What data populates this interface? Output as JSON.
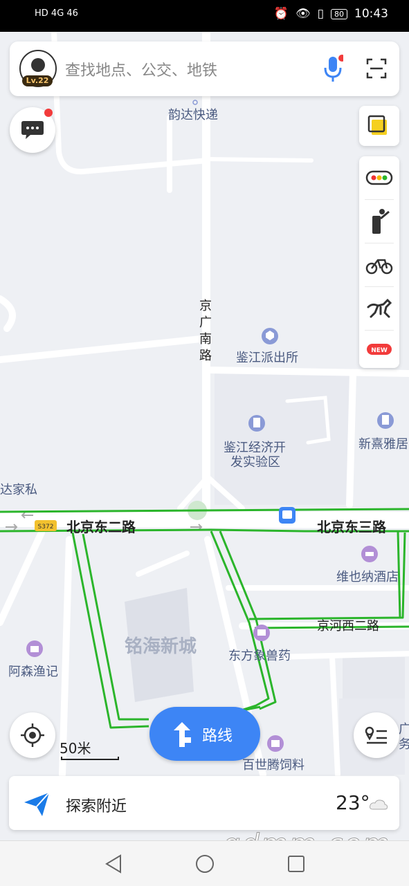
{
  "status_bar": {
    "left": "HD 4G 46",
    "battery": "80",
    "time": "10:43"
  },
  "search": {
    "placeholder": "查找地点、公交、地铁",
    "level": "Lv.22"
  },
  "map_labels": {
    "poi_express": "韵达快递",
    "road_jingguang_1": "京",
    "road_jingguang_2": "广",
    "road_jingguang_3": "南",
    "road_jingguang_4": "路",
    "poi_police": "鉴江派出所",
    "poi_devzone_1": "鉴江经济开",
    "poi_devzone_2": "发实验区",
    "poi_xinxi": "新熹雅居",
    "poi_dajia": "达家私",
    "road_bj_east2": "北京东二路",
    "road_bj_east3": "北京东三路",
    "highway_badge": "S372",
    "poi_vienna": "维也纳酒店",
    "road_jinghe": "京河西二路",
    "area_minghai": "铭海新城",
    "poi_dongfang": "东方象兽药",
    "poi_asen": "阿森渔记",
    "poi_baishi": "百世腾饲料",
    "poi_right_edge_1": "广",
    "poi_right_edge_2": "务"
  },
  "scale": "50米",
  "route_button": "路线",
  "explore": {
    "label": "探索附近",
    "temperature": "23°"
  },
  "watermark": "gdmm.com",
  "colors": {
    "route": "#2bb52b",
    "accent": "#3d85f5",
    "poi": "#8a9ad6"
  },
  "icons": [
    "message-icon",
    "layers-icon",
    "traffic-icon",
    "walk-icon",
    "bike-icon",
    "horse-icon",
    "new-badge-icon",
    "locate-icon",
    "list-icon",
    "navigate-arrow-icon",
    "weather-cloud-icon",
    "mic-icon",
    "scan-icon"
  ]
}
